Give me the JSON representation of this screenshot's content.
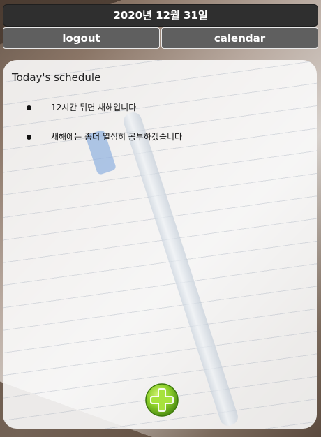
{
  "header": {
    "date": "2020년 12월 31일"
  },
  "nav": {
    "logout_label": "logout",
    "calendar_label": "calendar"
  },
  "schedule": {
    "title": "Today's schedule",
    "items": [
      {
        "text": "12시간 뒤면 새해입니다"
      },
      {
        "text": "새해에는 좀더 열심히 공부하겠습니다"
      }
    ]
  },
  "add_button": {
    "icon": "plus-icon",
    "color": "#7dc21e"
  }
}
